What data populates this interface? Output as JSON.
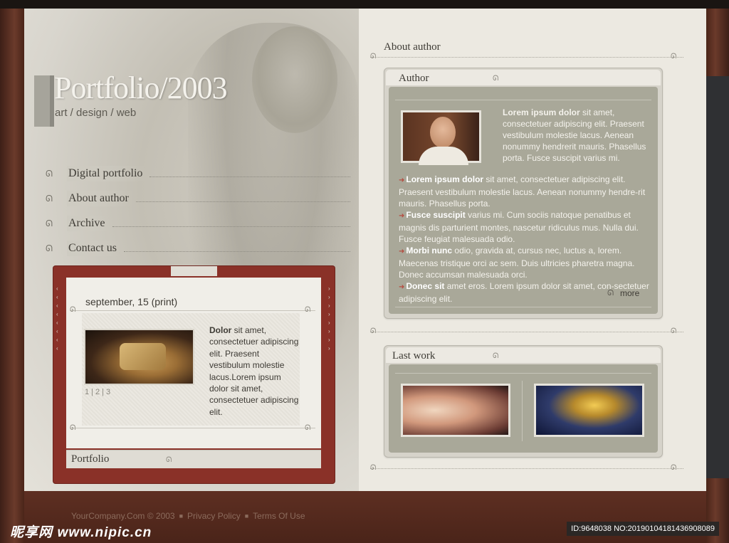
{
  "site": {
    "logo_title": "Portfolio/2003",
    "tagline": "art / design / web"
  },
  "nav": [
    {
      "label": "Digital portfolio"
    },
    {
      "label": "About author"
    },
    {
      "label": "Archive"
    },
    {
      "label": "Contact us"
    }
  ],
  "news_card": {
    "date": "september, 15 (print)",
    "pager": [
      "1",
      "|",
      "2",
      "|",
      "3"
    ],
    "text_bold": "Dolor",
    "text_rest": " sit amet, consectetuer adipiscing elit. Praesent vestibulum molestie lacus.Lorem ipsum dolor sit amet, consectetuer adipiscing elit.",
    "footer_title": "Portfolio"
  },
  "about": {
    "section_title": "About author",
    "panel_title": "Author",
    "intro_bold": "Lorem ipsum dolor",
    "intro_rest": " sit amet, consectetuer adipiscing elit. Praesent vestibulum molestie lacus. Aenean nonummy hendrerit mauris. Phasellus porta. Fusce suscipit varius mi.",
    "bullets": [
      {
        "bold": "Lorem ipsum dolor",
        "rest": " sit amet, consectetuer adipiscing elit. Praesent vestibulum molestie lacus. Aenean nonummy hendre-rit mauris. Phasellus porta."
      },
      {
        "bold": "Fusce suscipit",
        "rest": " varius mi. Cum sociis natoque penatibus et magnis dis parturient montes, nascetur ridiculus mus. Nulla dui. Fusce feugiat malesuada odio."
      },
      {
        "bold": "Morbi nunc",
        "rest": " odio, gravida at, cursus nec, luctus a, lorem. Maecenas tristique orci ac sem. Duis ultricies pharetra magna. Donec accumsan malesuada orci."
      },
      {
        "bold": "Donec sit",
        "rest": " amet eros. Lorem ipsum dolor sit amet, con-sectetuer adipiscing elit."
      }
    ],
    "more_label": "more"
  },
  "last_work": {
    "panel_title": "Last work"
  },
  "footer": {
    "copyright": "YourCompany.Com © 2003",
    "privacy": "Privacy Policy",
    "terms": "Terms Of Use"
  },
  "watermark": {
    "brand": "昵享网",
    "url": "www.nipic.cn",
    "id": "ID:9648038 NO:20190104181436908089"
  },
  "colors": {
    "frame_brown": "#5a2e22",
    "card_red": "#8a3128",
    "panel_olive": "#a9a899",
    "accent_arrow": "#b54b3f"
  }
}
